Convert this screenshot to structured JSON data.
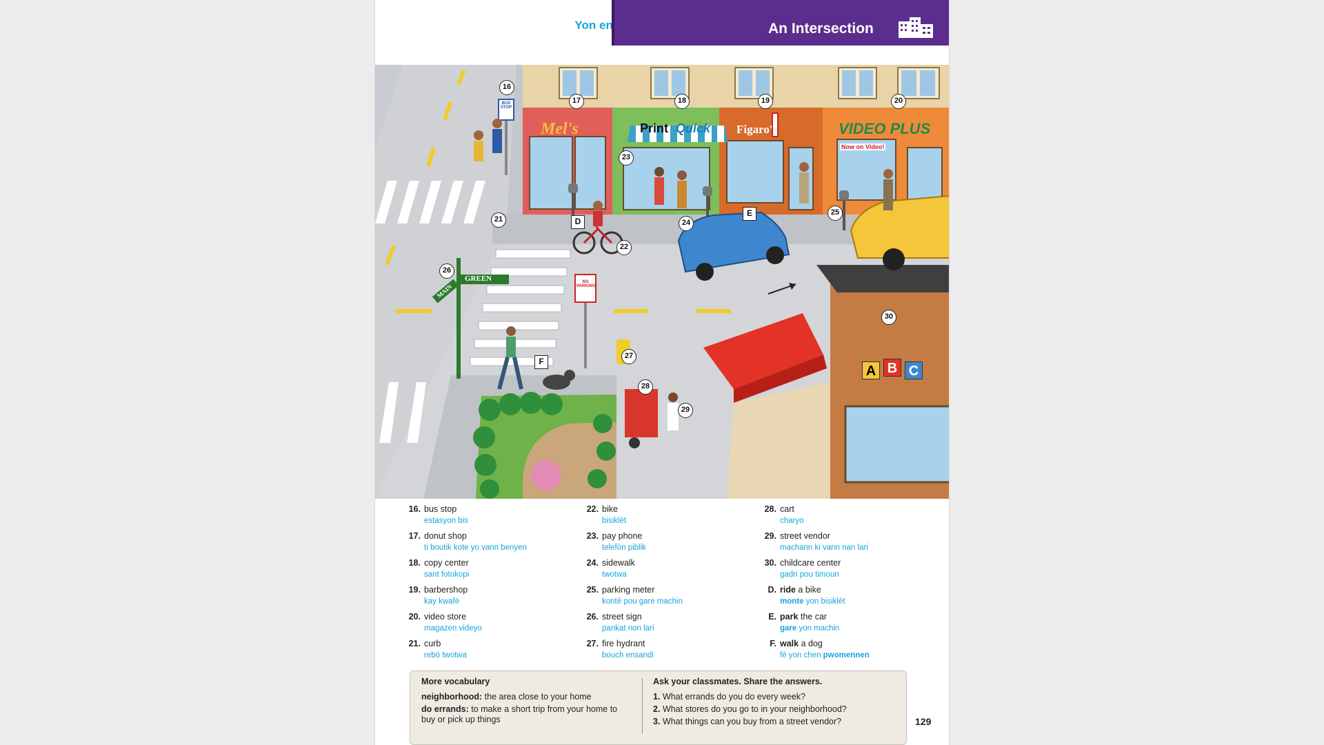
{
  "header": {
    "title_ht": "Yon entèseksyon",
    "title_en": "An Intersection"
  },
  "scene": {
    "callouts": [
      "16",
      "17",
      "18",
      "19",
      "20",
      "21",
      "22",
      "23",
      "24",
      "25",
      "26",
      "27",
      "28",
      "29",
      "30"
    ],
    "letters": [
      "D",
      "E",
      "F"
    ],
    "signs": {
      "bus_stop": "BUS STOP",
      "donut": "Mel's",
      "print": "Print",
      "quick": "Quick",
      "barber": "Figaro's",
      "video": "VIDEO PLUS",
      "now_on_video": "Now on Video!",
      "green": "GREEN",
      "main": "MAIN",
      "no_parking": "NO PARKING",
      "abc": [
        "A",
        "B",
        "C"
      ]
    }
  },
  "vocab": {
    "col1": [
      {
        "n": "16.",
        "en": "bus stop",
        "ht": "estasyon bis"
      },
      {
        "n": "17.",
        "en": "donut shop",
        "ht": "ti boutik kote yo vann benyen"
      },
      {
        "n": "18.",
        "en": "copy center",
        "ht": "sant fotokopi"
      },
      {
        "n": "19.",
        "en": "barbershop",
        "ht": "kay kwafè"
      },
      {
        "n": "20.",
        "en": "video store",
        "ht": "magazen videyo"
      },
      {
        "n": "21.",
        "en": "curb",
        "ht": "rebò twotwa"
      }
    ],
    "col2": [
      {
        "n": "22.",
        "en": "bike",
        "ht": "bisiklèt"
      },
      {
        "n": "23.",
        "en": "pay phone",
        "ht": "telefòn piblik"
      },
      {
        "n": "24.",
        "en": "sidewalk",
        "ht": "twotwa"
      },
      {
        "n": "25.",
        "en": "parking meter",
        "ht": "kontè pou gare machin"
      },
      {
        "n": "26.",
        "en": "street sign",
        "ht": "pankat non lari"
      },
      {
        "n": "27.",
        "en": "fire hydrant",
        "ht": "bouch ensandi"
      }
    ],
    "col3": [
      {
        "n": "28.",
        "en": "cart",
        "ht": "charyo"
      },
      {
        "n": "29.",
        "en": "street vendor",
        "ht": "machann ki vann nan lari"
      },
      {
        "n": "30.",
        "en": "childcare center",
        "ht": "gadri pou timoun"
      },
      {
        "n": "D.",
        "en_bold": "ride",
        "en_rest": " a bike",
        "ht_bold": "monte",
        "ht_rest": " yon bisiklèt"
      },
      {
        "n": "E.",
        "en_bold": "park",
        "en_rest": " the car",
        "ht_bold": "gare",
        "ht_rest": " yon machin"
      },
      {
        "n": "F.",
        "en_bold": "walk",
        "en_rest": " a dog",
        "ht_pre": "fè yon chen ",
        "ht_bold2": "pwomennen"
      }
    ]
  },
  "more_vocab": {
    "title": "More vocabulary",
    "def1_term": "neighborhood:",
    "def1_text": " the area close to your home",
    "def2_term": "do errands:",
    "def2_text": " to make a short trip from your home to",
    "def2_text2": "buy or pick up things"
  },
  "ask": {
    "title": "Ask your classmates. Share the answers.",
    "q1_n": "1.",
    "q1": "What errands do you do every week?",
    "q2_n": "2.",
    "q2": "What stores do you go to in your neighborhood?",
    "q3_n": "3.",
    "q3": "What things can you buy from a street vendor?"
  },
  "page_number": "129",
  "colors": {
    "purple": "#5b2d8e",
    "cyan": "#16a3dd",
    "box": "#efebe3"
  }
}
